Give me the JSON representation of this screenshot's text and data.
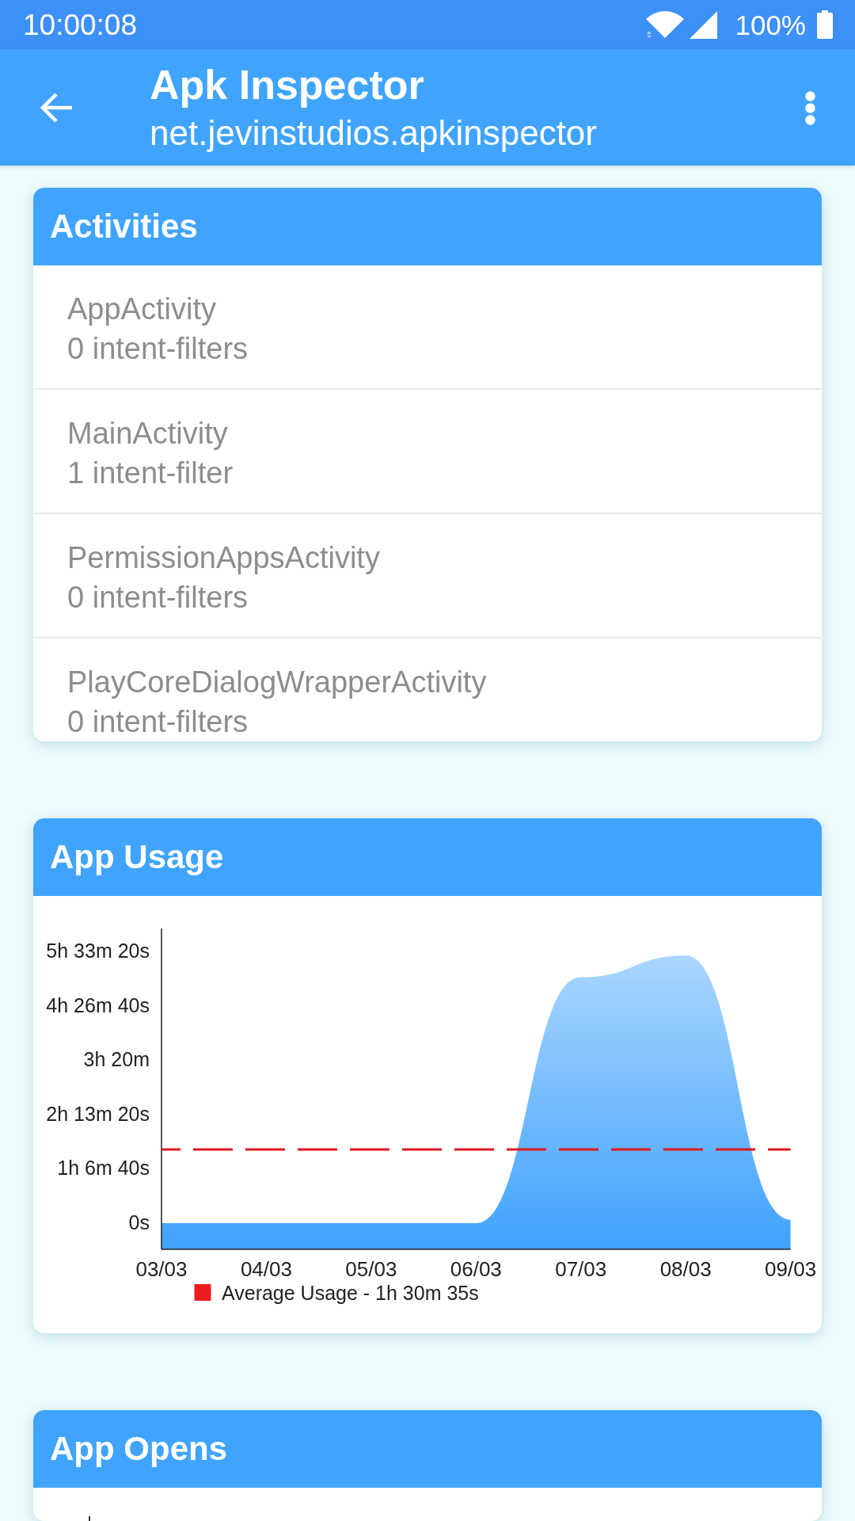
{
  "status_bar": {
    "time": "10:00:08",
    "battery": "100%"
  },
  "app_bar": {
    "title": "Apk Inspector",
    "subtitle": "net.jevinstudios.apkinspector"
  },
  "activities": {
    "title": "Activities",
    "items": [
      {
        "name": "AppActivity",
        "detail": "0 intent-filters"
      },
      {
        "name": "MainActivity",
        "detail": "1 intent-filter"
      },
      {
        "name": "PermissionAppsActivity",
        "detail": "0 intent-filters"
      },
      {
        "name": "PlayCoreDialogWrapperActivity",
        "detail": "0 intent-filters"
      }
    ]
  },
  "app_usage": {
    "title": "App Usage",
    "y_axis_labels": [
      "5h 33m 20s",
      "4h 26m 40s",
      "3h 20m",
      "2h 13m 20s",
      "1h 6m 40s",
      "0s"
    ],
    "x_axis_labels": [
      "03/03",
      "04/03",
      "05/03",
      "06/03",
      "07/03",
      "08/03",
      "09/03"
    ],
    "legend": "Average Usage - 1h 30m 35s"
  },
  "app_opens": {
    "title": "App Opens"
  }
}
